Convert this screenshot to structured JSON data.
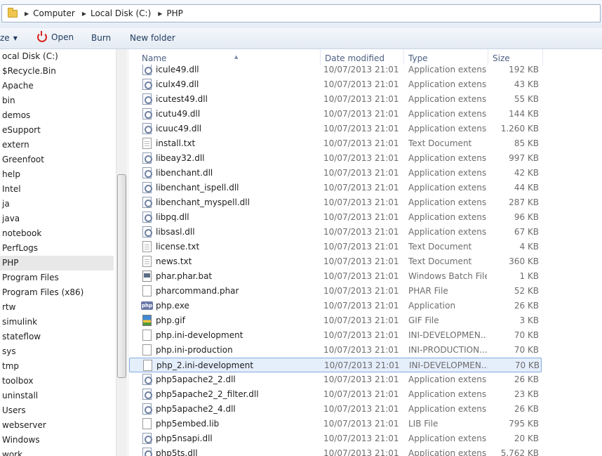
{
  "address": {
    "crumbs": [
      "Computer",
      "Local Disk (C:)",
      "PHP"
    ]
  },
  "toolbar": {
    "cut_label": "ze",
    "open_label": "Open",
    "burn_label": "Burn",
    "new_folder_label": "New folder"
  },
  "sidebar": {
    "items": [
      {
        "label": "ocal Disk (C:)"
      },
      {
        "label": "$Recycle.Bin"
      },
      {
        "label": "Apache"
      },
      {
        "label": "bin"
      },
      {
        "label": "demos"
      },
      {
        "label": "eSupport"
      },
      {
        "label": "extern"
      },
      {
        "label": "Greenfoot"
      },
      {
        "label": "help"
      },
      {
        "label": "Intel"
      },
      {
        "label": "ja"
      },
      {
        "label": "java"
      },
      {
        "label": "notebook"
      },
      {
        "label": "PerfLogs"
      },
      {
        "label": "PHP"
      },
      {
        "label": "Program Files"
      },
      {
        "label": "Program Files (x86)"
      },
      {
        "label": "rtw"
      },
      {
        "label": "simulink"
      },
      {
        "label": "stateflow"
      },
      {
        "label": "sys"
      },
      {
        "label": "tmp"
      },
      {
        "label": "toolbox"
      },
      {
        "label": "uninstall"
      },
      {
        "label": "Users"
      },
      {
        "label": "webserver"
      },
      {
        "label": "Windows"
      },
      {
        "label": "work"
      }
    ],
    "selected": "PHP"
  },
  "columns": {
    "name": "Name",
    "date": "Date modified",
    "type": "Type",
    "size": "Size"
  },
  "files": [
    {
      "name": "icule49.dll",
      "date": "10/07/2013 21:01",
      "type": "Application extens...",
      "size": "192 KB",
      "icon": "dll-icon"
    },
    {
      "name": "iculx49.dll",
      "date": "10/07/2013 21:01",
      "type": "Application extens...",
      "size": "43 KB",
      "icon": "dll-icon"
    },
    {
      "name": "icutest49.dll",
      "date": "10/07/2013 21:01",
      "type": "Application extens...",
      "size": "55 KB",
      "icon": "dll-icon"
    },
    {
      "name": "icutu49.dll",
      "date": "10/07/2013 21:01",
      "type": "Application extens...",
      "size": "144 KB",
      "icon": "dll-icon"
    },
    {
      "name": "icuuc49.dll",
      "date": "10/07/2013 21:01",
      "type": "Application extens...",
      "size": "1.260 KB",
      "icon": "dll-icon"
    },
    {
      "name": "install.txt",
      "date": "10/07/2013 21:01",
      "type": "Text Document",
      "size": "85 KB",
      "icon": "text-document-icon"
    },
    {
      "name": "libeay32.dll",
      "date": "10/07/2013 21:01",
      "type": "Application extens...",
      "size": "997 KB",
      "icon": "dll-icon"
    },
    {
      "name": "libenchant.dll",
      "date": "10/07/2013 21:01",
      "type": "Application extens...",
      "size": "42 KB",
      "icon": "dll-icon"
    },
    {
      "name": "libenchant_ispell.dll",
      "date": "10/07/2013 21:01",
      "type": "Application extens...",
      "size": "44 KB",
      "icon": "dll-icon"
    },
    {
      "name": "libenchant_myspell.dll",
      "date": "10/07/2013 21:01",
      "type": "Application extens...",
      "size": "287 KB",
      "icon": "dll-icon"
    },
    {
      "name": "libpq.dll",
      "date": "10/07/2013 21:01",
      "type": "Application extens...",
      "size": "96 KB",
      "icon": "dll-icon"
    },
    {
      "name": "libsasl.dll",
      "date": "10/07/2013 21:01",
      "type": "Application extens...",
      "size": "67 KB",
      "icon": "dll-icon"
    },
    {
      "name": "license.txt",
      "date": "10/07/2013 21:01",
      "type": "Text Document",
      "size": "4 KB",
      "icon": "text-document-icon"
    },
    {
      "name": "news.txt",
      "date": "10/07/2013 21:01",
      "type": "Text Document",
      "size": "360 KB",
      "icon": "text-document-icon"
    },
    {
      "name": "phar.phar.bat",
      "date": "10/07/2013 21:01",
      "type": "Windows Batch File",
      "size": "1 KB",
      "icon": "batch-file-icon"
    },
    {
      "name": "pharcommand.phar",
      "date": "10/07/2013 21:01",
      "type": "PHAR File",
      "size": "52 KB",
      "icon": "blank-file-icon"
    },
    {
      "name": "php.exe",
      "date": "10/07/2013 21:01",
      "type": "Application",
      "size": "26 KB",
      "icon": "php-exe-icon"
    },
    {
      "name": "php.gif",
      "date": "10/07/2013 21:01",
      "type": "GIF File",
      "size": "3 KB",
      "icon": "image-file-icon"
    },
    {
      "name": "php.ini-development",
      "date": "10/07/2013 21:01",
      "type": "INI-DEVELOPMEN...",
      "size": "70 KB",
      "icon": "blank-file-icon"
    },
    {
      "name": "php.ini-production",
      "date": "10/07/2013 21:01",
      "type": "INI-PRODUCTION...",
      "size": "70 KB",
      "icon": "blank-file-icon"
    },
    {
      "name": "php_2.ini-development",
      "date": "10/07/2013 21:01",
      "type": "INI-DEVELOPMEN...",
      "size": "70 KB",
      "icon": "blank-file-icon",
      "selected": true
    },
    {
      "name": "php5apache2_2.dll",
      "date": "10/07/2013 21:01",
      "type": "Application extens...",
      "size": "26 KB",
      "icon": "dll-icon"
    },
    {
      "name": "php5apache2_2_filter.dll",
      "date": "10/07/2013 21:01",
      "type": "Application extens...",
      "size": "23 KB",
      "icon": "dll-icon"
    },
    {
      "name": "php5apache2_4.dll",
      "date": "10/07/2013 21:01",
      "type": "Application extens...",
      "size": "26 KB",
      "icon": "dll-icon"
    },
    {
      "name": "php5embed.lib",
      "date": "10/07/2013 21:01",
      "type": "LIB File",
      "size": "795 KB",
      "icon": "blank-file-icon"
    },
    {
      "name": "php5nsapi.dll",
      "date": "10/07/2013 21:01",
      "type": "Application extens...",
      "size": "20 KB",
      "icon": "dll-icon"
    },
    {
      "name": "php5ts.dll",
      "date": "10/07/2013 21:01",
      "type": "Application extens...",
      "size": "5.762 KB",
      "icon": "dll-icon"
    }
  ],
  "colors": {
    "selection_bg": "#e5eefb",
    "selection_border": "#84acdd",
    "header_text": "#4d6082",
    "secondary_text": "#6d6d6d"
  }
}
